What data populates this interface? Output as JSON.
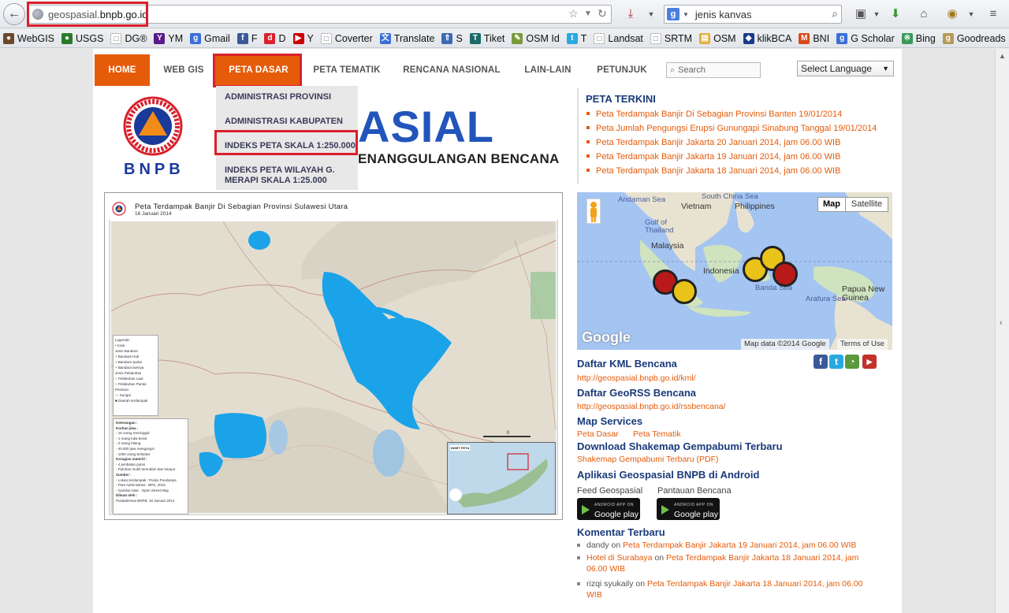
{
  "browser": {
    "url_prefix": "geospasial.",
    "url_domain": "bnpb.go.id",
    "search_value": "jenis kanvas",
    "search_engine_letter": "g",
    "bookmarks": [
      {
        "label": "WebGIS",
        "color": "#6a4a2a",
        "glyph": "●"
      },
      {
        "label": "USGS",
        "color": "#2a7a2a",
        "glyph": "●"
      },
      {
        "label": "DG®",
        "color": "#ffffff",
        "glyph": "□"
      },
      {
        "label": "YM",
        "color": "#5a1a8a",
        "glyph": "Y"
      },
      {
        "label": "Gmail",
        "color": "#3b6fd8",
        "glyph": "g"
      },
      {
        "label": "F",
        "color": "#3b5998",
        "glyph": "f"
      },
      {
        "label": "D",
        "color": "#d9202c",
        "glyph": "d"
      },
      {
        "label": "Y",
        "color": "#cc0000",
        "glyph": "▶"
      },
      {
        "label": "Coverter",
        "color": "#ffffff",
        "glyph": "□"
      },
      {
        "label": "Translate",
        "color": "#3b6fd8",
        "glyph": "文"
      },
      {
        "label": "S",
        "color": "#3a6ab5",
        "glyph": "⇑"
      },
      {
        "label": "Tiket",
        "color": "#1a6a6a",
        "glyph": "T"
      },
      {
        "label": "OSM Id",
        "color": "#7a9a3a",
        "glyph": "✎"
      },
      {
        "label": "T",
        "color": "#29a9e1",
        "glyph": "t"
      },
      {
        "label": "Landsat",
        "color": "#ffffff",
        "glyph": "□"
      },
      {
        "label": "SRTM",
        "color": "#ffffff",
        "glyph": "□"
      },
      {
        "label": "OSM",
        "color": "#e0b040",
        "glyph": "▤"
      },
      {
        "label": "klikBCA",
        "color": "#1a3a8a",
        "glyph": "◆"
      },
      {
        "label": "BNI",
        "color": "#d94a1a",
        "glyph": "M"
      },
      {
        "label": "G Scholar",
        "color": "#3b6fd8",
        "glyph": "g"
      },
      {
        "label": "Bing",
        "color": "#3a9a5a",
        "glyph": "※"
      },
      {
        "label": "Goodreads",
        "color": "#b59a5a",
        "glyph": "g"
      }
    ]
  },
  "nav": {
    "home": "HOME",
    "web_gis": "WEB GIS",
    "peta_dasar": "PETA DASAR",
    "peta_tematik": "PETA TEMATIK",
    "rencana_nasional": "RENCANA NASIONAL",
    "lain_lain": "LAIN-LAIN",
    "petunjuk": "PETUNJUK",
    "search_placeholder": "Search",
    "language": "Select Language"
  },
  "dropdown": {
    "items": [
      "ADMINISTRASI PROVINSI",
      "ADMINISTRASI KABUPATEN",
      "INDEKS PETA SKALA 1:250.000",
      "INDEKS PETA WILAYAH G. MERAPI SKALA 1:25.000"
    ]
  },
  "header": {
    "logo_text": "BNPB",
    "title_visible": "ASIAL",
    "subtitle_visible": "ENANGGULANGAN BENCANA"
  },
  "main_map": {
    "title": "Peta Terdampak Banjir Di Sebagian Provinsi Sulawesi Utara",
    "date": "16 Januari 2014",
    "legend_lines": [
      "Legenda:",
      "• Kota",
      "Jenis Bandara",
      "+ Bandara Hub",
      "+ Bandara spoke",
      "+ Bandara lainnya",
      "Jenis Pelabuhan",
      "○ Pelabuhan Laut",
      "○ Pelabuhan Pantai",
      "Perairan",
      "— Sungai",
      "■ Daerah terdampak"
    ],
    "info_lines": [
      "Keterangan :",
      "Korban jiwa :",
      "- 15 orang meninggal",
      "- 1 orang luka berat",
      "- 2 orang hilang",
      "- 40.000 jiwa mengungsi",
      "- 1000 orang terlantar",
      "Kerugian materiil :",
      "- 4 jembatan putus",
      "- Puluhan mobil terendam dan hanyut",
      "Sumber :",
      "- Lokasi terdampak : Posko Pusdalops",
      "- Peta Administrasi : BPS, 2010",
      "- Gambar latar : Open Street Map",
      "Dibuat oleh :",
      "Pusdatinmas BNPB, 16 Januari 2014"
    ],
    "inset_label": "INSET PETA"
  },
  "peta_terkini": {
    "title": "PETA TERKINI",
    "items": [
      "Peta Terdampak Banjir Di Sebagian Provinsi Banten 19/01/2014",
      "Peta Jumlah Pengungsi Erupsi Gunungapi Sinabung Tanggal 19/01/2014",
      "Peta Terdampak Banjir Jakarta 20 Januari 2014, jam 06.00 WIB",
      "Peta Terdampak Banjir Jakarta 19 Januari 2014, jam 06.00 WIB",
      "Peta Terdampak Banjir Jakarta 18 Januari 2014, jam 06.00 WIB"
    ]
  },
  "google_map": {
    "btn_map": "Map",
    "btn_satellite": "Satellite",
    "labels": {
      "andaman_sea": "Andaman Sea",
      "south_china_sea": "South China Sea",
      "vietnam": "Vietnam",
      "philippines": "Philippines",
      "gulf_thailand": "Gulf of Thailand",
      "malaysia": "Malaysia",
      "indonesia": "Indonesia",
      "banda_sea": "Banda Sea",
      "arafura_sea": "Arafura Sea",
      "papua": "Papua New Guinea"
    },
    "google_logo": "Google",
    "attribution": "Map data ©2014 Google",
    "terms": "Terms of Use"
  },
  "sections": {
    "kml_title": "Daftar KML Bencana",
    "kml_link": "http://geospasial.bnpb.go.id/kml/",
    "georss_title": "Daftar GeoRSS Bencana",
    "georss_link": "http://geospasial.bnpb.go.id/rssbencana/",
    "map_services_title": "Map Services",
    "map_services_link1": "Peta Dasar",
    "map_services_link2": "Peta Tematik",
    "shakemap_title": "Download Shakemap Gempabumi Terbaru",
    "shakemap_link": "Shakemap Gempabumi Terbaru (PDF)",
    "android_title": "Aplikasi Geospasial BNPB di Android",
    "app1_label": "Feed Geospasial",
    "app2_label": "Pantauan Bencana",
    "gplay_small": "ANDROID APP ON",
    "gplay_text": "Google play",
    "komentar_title": "Komentar Terbaru"
  },
  "social": {
    "facebook": "f",
    "twitter": "t",
    "youtube": "▶"
  },
  "comments": [
    {
      "author": "dandy",
      "on": " on ",
      "link": "Peta Terdampak Banjir Jakarta 19 Januari 2014, jam 06.00 WIB"
    },
    {
      "author": "Hotel di Surabaya",
      "on": " on ",
      "link": "Peta Terdampak Banjir Jakarta 18 Januari 2014, jam 06.00 WIB"
    },
    {
      "author": "rizqi syukaily",
      "on": " on ",
      "link": "Peta Terdampak Banjir Jakarta 18 Januari 2014, jam 06.00 WIB"
    }
  ],
  "colors": {
    "accent_orange": "#e55b0a",
    "highlight_red": "#d9202c",
    "title_blue": "#2255bb",
    "flood_blue": "#1aa3e8"
  }
}
